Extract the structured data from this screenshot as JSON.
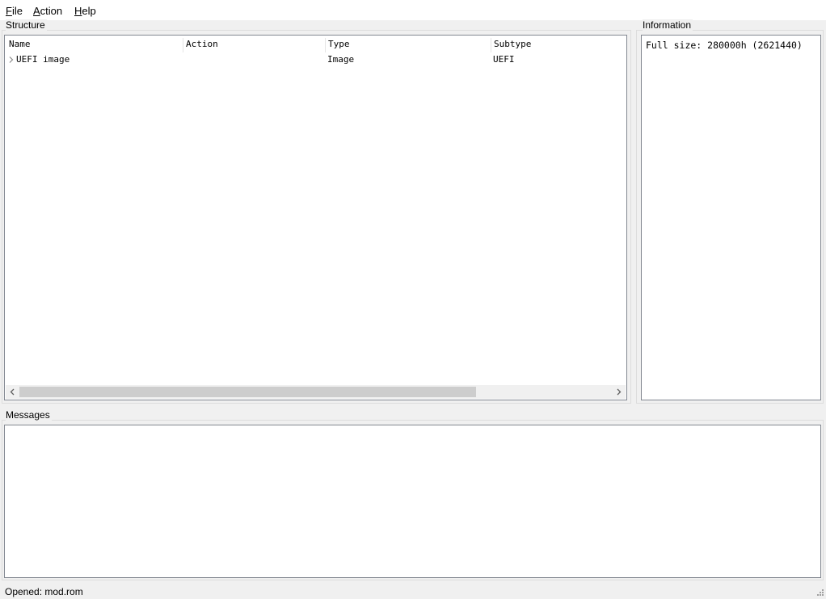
{
  "menubar": {
    "file": {
      "label_first": "F",
      "label_rest": "ile"
    },
    "action": {
      "label_first": "A",
      "label_rest": "ction"
    },
    "help": {
      "label_first": "H",
      "label_rest": "elp"
    }
  },
  "structure": {
    "title": "Structure",
    "columns": [
      "Name",
      "Action",
      "Type",
      "Subtype"
    ],
    "rows": [
      {
        "name": "UEFI image",
        "action": "",
        "type": "Image",
        "subtype": "UEFI"
      }
    ]
  },
  "information": {
    "title": "Information",
    "text": "Full size: 280000h (2621440)"
  },
  "messages": {
    "title": "Messages"
  },
  "statusbar": {
    "text": "Opened: mod.rom"
  },
  "icons": {
    "expander": "chevron-right-icon",
    "scroll_left": "chevron-left-icon",
    "scroll_right": "chevron-right-icon",
    "size_grip": "size-grip-icon"
  }
}
